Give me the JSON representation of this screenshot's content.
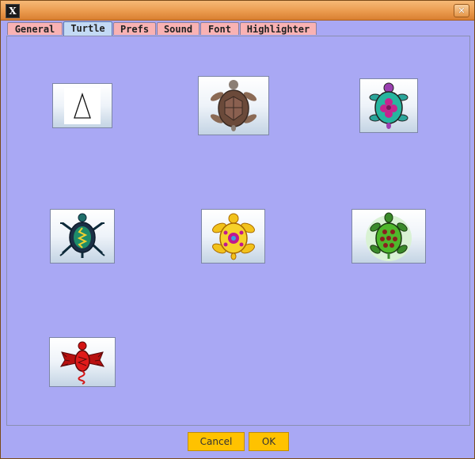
{
  "tabs": [
    {
      "label": "General",
      "active": false
    },
    {
      "label": "Turtle",
      "active": true
    },
    {
      "label": "Prefs",
      "active": false
    },
    {
      "label": "Sound",
      "active": false
    },
    {
      "label": "Font",
      "active": false
    },
    {
      "label": "Highlighter",
      "active": false
    }
  ],
  "turtle_options": [
    {
      "icon": "triangle-turtle-icon"
    },
    {
      "icon": "brown-turtle-icon"
    },
    {
      "icon": "purple-teal-turtle-icon"
    },
    {
      "icon": "tribal-green-turtle-icon"
    },
    {
      "icon": "yellow-turtle-icon"
    },
    {
      "icon": "green-spotted-turtle-icon"
    },
    {
      "icon": "red-dragon-turtle-icon"
    }
  ],
  "buttons": {
    "cancel": "Cancel",
    "ok": "OK"
  },
  "colors": {
    "background": "#a9a8f4",
    "tab_inactive": "#f9b2b3",
    "tab_active": "#c3daf5",
    "button": "#ffc200",
    "titlebar": "#eb9b4e"
  }
}
